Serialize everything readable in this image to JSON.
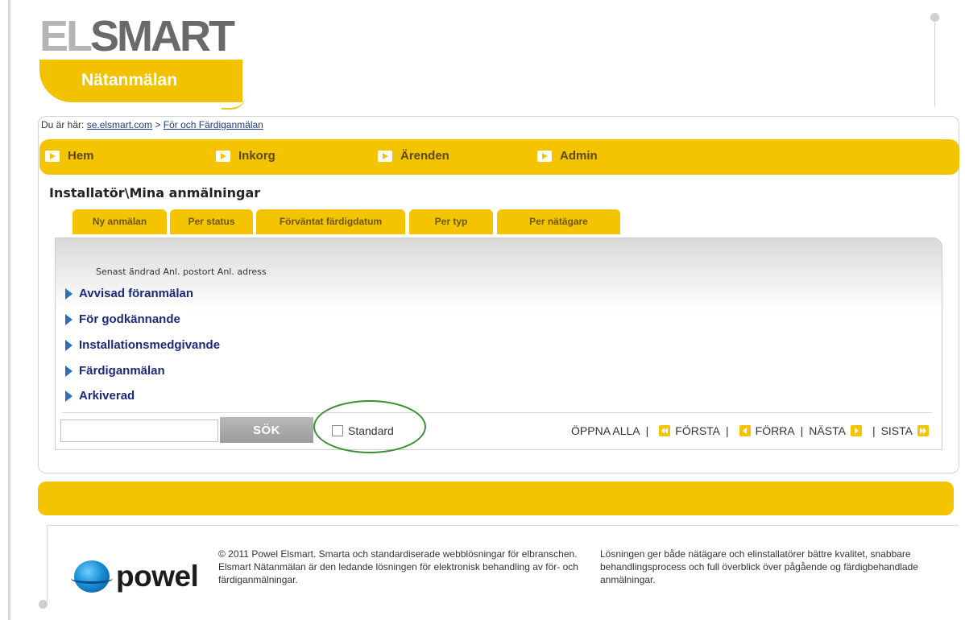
{
  "logo": {
    "brand_light": "EL",
    "brand_dark": "SMART",
    "sub": "Nätanmälan"
  },
  "breadcrumb": {
    "prefix": "Du är här:",
    "link1": "se.elsmart.com",
    "sep": ">",
    "link2": "För och Färdiganmälan"
  },
  "nav": {
    "items": [
      "Hem",
      "Inkorg",
      "Ärenden",
      "Admin"
    ]
  },
  "page_title": "Installatör\\Mina anmälningar",
  "tabs": [
    "Ny anmälan",
    "Per status",
    "Förväntat färdigdatum",
    "Per typ",
    "Per nätägare"
  ],
  "columns": "Senast ändrad Anl. postort Anl. adress",
  "statuses": [
    "Avvisad föranmälan",
    "För godkännande",
    "Installationsmedgivande",
    "Färdiganmälan",
    "Arkiverad"
  ],
  "search": {
    "value": "",
    "button": "SÖK"
  },
  "standard": {
    "label": "Standard",
    "checked": false
  },
  "pager": {
    "open_all": "ÖPPNA ALLA",
    "first": "FÖRSTA",
    "prev": "FÖRRA",
    "next": "NÄSTA",
    "last": "SISTA",
    "sep": "|"
  },
  "footer": {
    "brand": "powel",
    "copyright": "© 2011 Powel Elsmart. Smarta och standardiserade webblösningar för elbranschen. Elsmart Nätanmälan är den ledande lösningen för elektronisk behandling av för- och färdiganmälningar.",
    "description": "Lösningen ger både nätägare och elinstallatörer bättre kvalitet, snabbare behandlingsprocess och full överblick över pågående og färdigbehandlade anmälningar."
  },
  "colors": {
    "accent": "#f5c400",
    "link": "#1a2a7a",
    "status_arrow": "#2f6fb8",
    "highlight_ring": "#3b8f34"
  }
}
